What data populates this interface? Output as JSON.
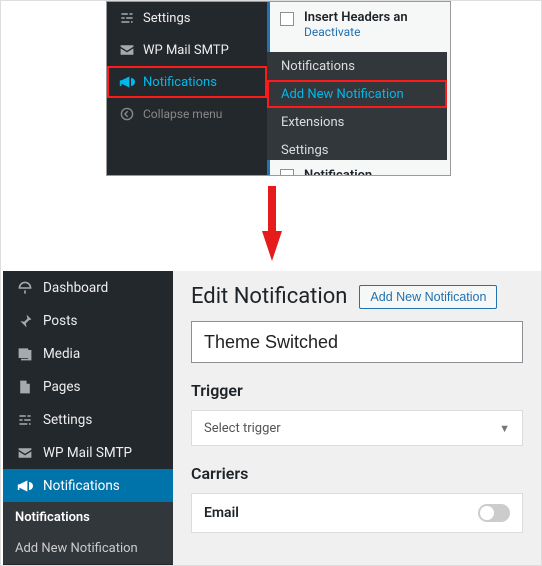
{
  "part1": {
    "sidebar": {
      "settings": "Settings",
      "wp_mail_smtp": "WP Mail SMTP",
      "notifications": "Notifications",
      "collapse": "Collapse menu"
    },
    "submenu": {
      "notifications": "Notifications",
      "add_new": "Add New Notification",
      "extensions": "Extensions",
      "settings": "Settings"
    },
    "plugins": {
      "row1_name": "Insert Headers an",
      "row1_action": "Deactivate",
      "row2_name": "Notification"
    }
  },
  "part2": {
    "sidebar": {
      "dashboard": "Dashboard",
      "posts": "Posts",
      "media": "Media",
      "pages": "Pages",
      "settings": "Settings",
      "wp_mail_smtp": "WP Mail SMTP",
      "notifications": "Notifications"
    },
    "submenu": {
      "notifications": "Notifications",
      "add_new": "Add New Notification"
    },
    "main": {
      "title": "Edit Notification",
      "add_new_btn": "Add New Notification",
      "notif_name": "Theme Switched",
      "trigger_label": "Trigger",
      "trigger_placeholder": "Select trigger",
      "carriers_label": "Carriers",
      "carrier_email": "Email"
    }
  }
}
